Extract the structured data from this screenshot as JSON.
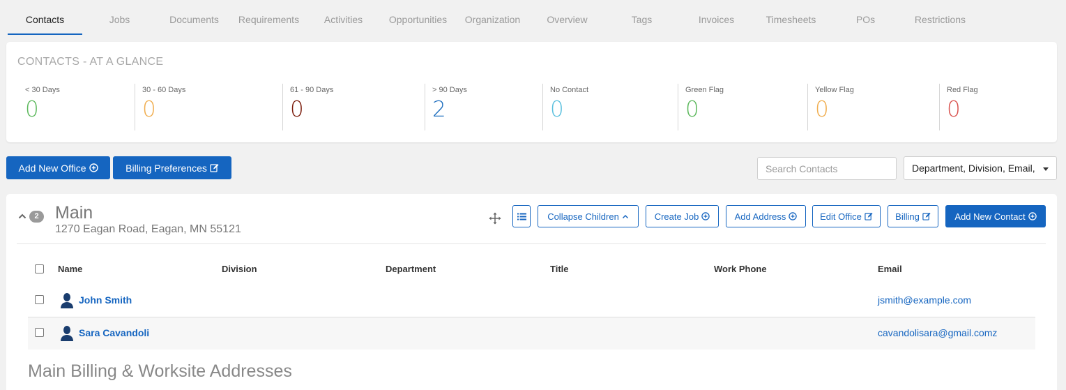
{
  "tabs": [
    {
      "label": "Contacts",
      "active": true
    },
    {
      "label": "Jobs"
    },
    {
      "label": "Documents"
    },
    {
      "label": "Requirements"
    },
    {
      "label": "Activities"
    },
    {
      "label": "Opportunities"
    },
    {
      "label": "Organization"
    },
    {
      "label": "Overview"
    },
    {
      "label": "Tags"
    },
    {
      "label": "Invoices"
    },
    {
      "label": "Timesheets"
    },
    {
      "label": "POs"
    },
    {
      "label": "Restrictions"
    }
  ],
  "glance": {
    "title": "CONTACTS - AT A GLANCE",
    "stats": [
      {
        "label": "< 30 Days",
        "value": "0",
        "color": "#5cb85c"
      },
      {
        "label": "30 - 60 Days",
        "value": "0",
        "color": "#f0ad4e"
      },
      {
        "label": "61 - 90 Days",
        "value": "0",
        "color": "#7a1a0a"
      },
      {
        "label": "> 90 Days",
        "value": "2",
        "color": "#1f6fbf"
      },
      {
        "label": "No Contact",
        "value": "0",
        "color": "#5bc0de"
      },
      {
        "label": "Green Flag",
        "value": "0",
        "color": "#5cb85c"
      },
      {
        "label": "Yellow Flag",
        "value": "0",
        "color": "#f0ad4e"
      },
      {
        "label": "Red Flag",
        "value": "0",
        "color": "#d9534f"
      }
    ]
  },
  "toolbar": {
    "add_office_label": "Add New Office",
    "billing_prefs_label": "Billing Preferences",
    "search_placeholder": "Search Contacts",
    "columns_select": "Department, Division, Email,"
  },
  "office": {
    "badge": "2",
    "name": "Main",
    "address": "1270 Eagan Road, Eagan, MN 55121",
    "buttons": {
      "collapse": "Collapse Children",
      "create_job": "Create Job",
      "add_address": "Add Address",
      "edit_office": "Edit Office",
      "billing": "Billing",
      "add_contact": "Add New Contact"
    },
    "columns": [
      "Name",
      "Division",
      "Department",
      "Title",
      "Work Phone",
      "Email"
    ],
    "contacts": [
      {
        "name": "John Smith",
        "division": "",
        "department": "",
        "title": "",
        "work_phone": "",
        "email": "jsmith@example.com"
      },
      {
        "name": "Sara Cavandoli",
        "division": "",
        "department": "",
        "title": "",
        "work_phone": "",
        "email": "cavandolisara@gmail.comz"
      }
    ],
    "addresses_title": "Main Billing & Worksite Addresses"
  },
  "colors": {
    "primary": "#1565c0"
  }
}
